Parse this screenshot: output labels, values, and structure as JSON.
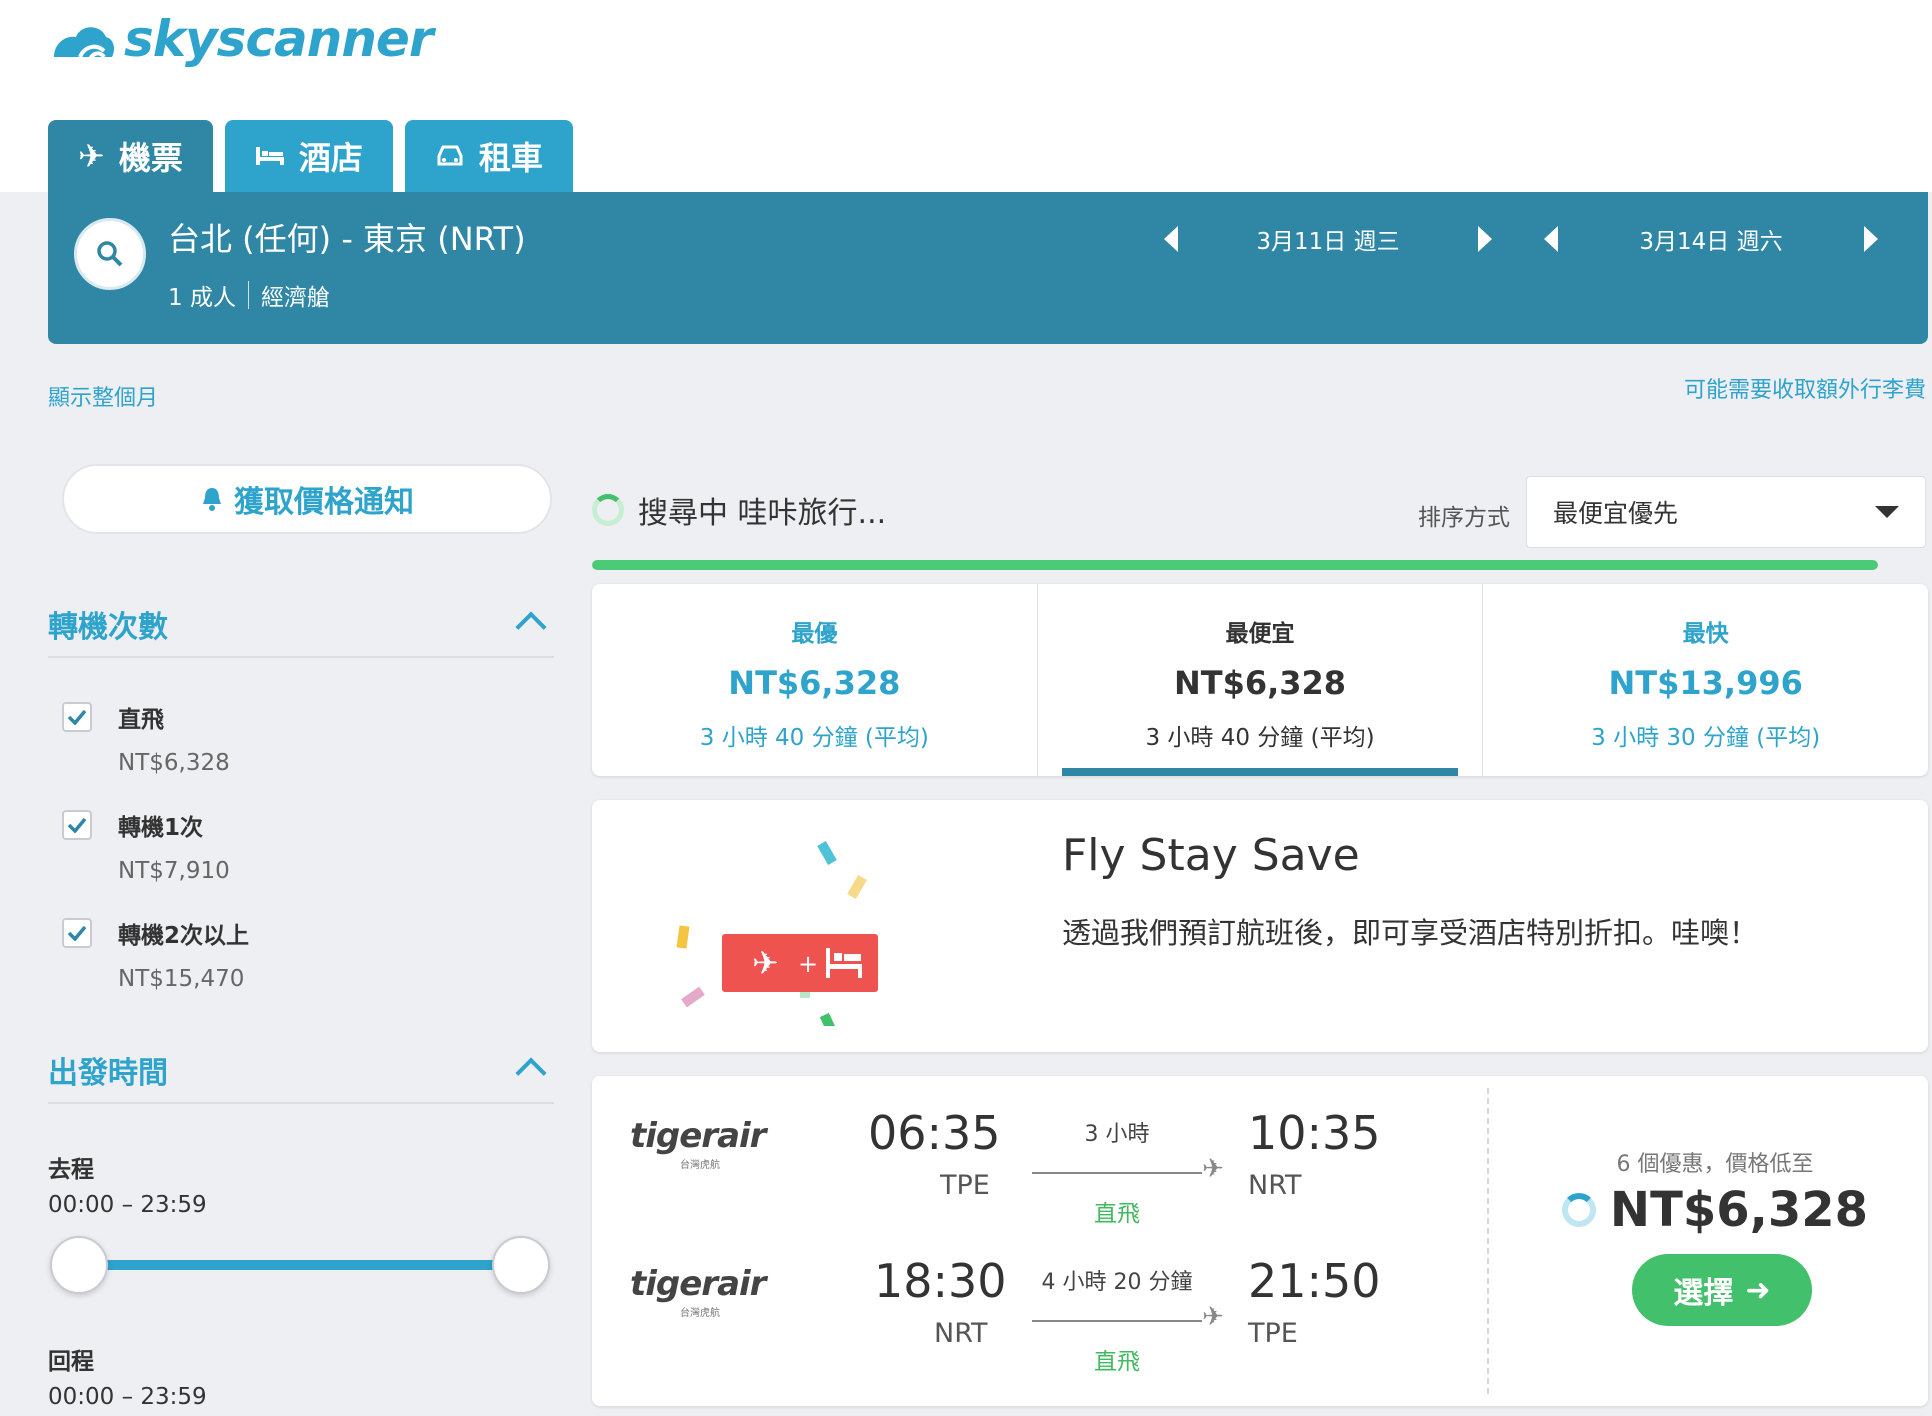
{
  "brand": {
    "logo_text": "skyscanner",
    "color": "#2ea3cc"
  },
  "tabs": [
    {
      "label": "機票",
      "icon": "plane-icon",
      "active": true
    },
    {
      "label": "酒店",
      "icon": "bed-icon",
      "active": false
    },
    {
      "label": "租車",
      "icon": "car-icon",
      "active": false
    }
  ],
  "search": {
    "route": "台北 (任何) - 東京 (NRT)",
    "passengers": "1 成人",
    "cabin": "經濟艙",
    "depart_date": "3月11日 週三",
    "return_date": "3月14日 週六"
  },
  "links": {
    "show_month": "顯示整個月",
    "baggage": "可能需要收取額外行李費"
  },
  "alerts": {
    "label": "獲取價格通知"
  },
  "filters": {
    "stops_title": "轉機次數",
    "stops": [
      {
        "name": "直飛",
        "price": "NT$6,328",
        "checked": true
      },
      {
        "name": "轉機1次",
        "price": "NT$7,910",
        "checked": true
      },
      {
        "name": "轉機2次以上",
        "price": "NT$15,470",
        "checked": true
      }
    ],
    "times_title": "出發時間",
    "outbound_label": "去程",
    "outbound_range": "00:00 – 23:59",
    "return_label": "回程",
    "return_range": "00:00 – 23:59"
  },
  "status": {
    "text": "搜尋中 哇咔旅行...",
    "progress": 1.0
  },
  "sort": {
    "label": "排序方式",
    "value": "最便宜優先"
  },
  "summary": [
    {
      "title": "最優",
      "price": "NT$6,328",
      "duration": "3 小時 40 分鐘 (平均)",
      "selected": false
    },
    {
      "title": "最便宜",
      "price": "NT$6,328",
      "duration": "3 小時 40 分鐘 (平均)",
      "selected": true
    },
    {
      "title": "最快",
      "price": "NT$13,996",
      "duration": "3 小時 30 分鐘 (平均)",
      "selected": false
    }
  ],
  "promo": {
    "title": "Fly Stay Save",
    "text": "透過我們預訂航班後，即可享受酒店特別折扣。哇噢！"
  },
  "result": {
    "legs": [
      {
        "airline": "tigerair",
        "airline_sub": "台灣虎航",
        "depart_time": "06:35",
        "depart_code": "TPE",
        "duration": "3 小時",
        "arrive_time": "10:35",
        "arrive_code": "NRT",
        "stops": "直飛"
      },
      {
        "airline": "tigerair",
        "airline_sub": "台灣虎航",
        "depart_time": "18:30",
        "depart_code": "NRT",
        "duration": "4 小時 20 分鐘",
        "arrive_time": "21:50",
        "arrive_code": "TPE",
        "stops": "直飛"
      }
    ],
    "deals": "6 個優惠，價格低至",
    "price": "NT$6,328",
    "select_label": "選擇"
  }
}
